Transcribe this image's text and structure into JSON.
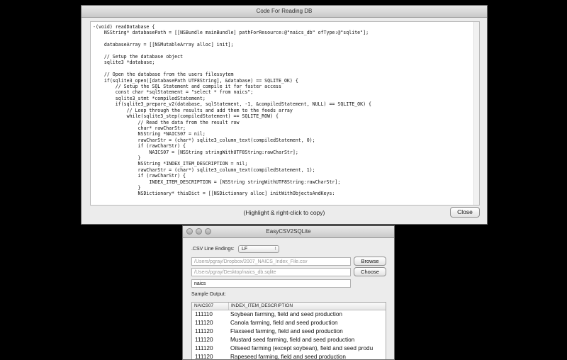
{
  "code_window": {
    "title": "Code For Reading DB",
    "code": "-(void) readDatabase {\n    NSString* databasePath = [[NSBundle mainBundle] pathForResource:@\"naics_db\" ofType:@\"sqlite\"];\n\n    databaseArray = [[NSMutableArray alloc] init];\n\n    // Setup the database object\n    sqlite3 *database;\n\n    // Open the database from the users filessytem\n    if(sqlite3_open([databasePath UTF8String], &database) == SQLITE_OK) {\n        // Setup the SQL Statement and compile it for faster access\n        const char *sqlStatement = \"select * from naics\";\n        sqlite3_stmt *compiledStatement;\n        if(sqlite3_prepare_v2(database, sqlStatement, -1, &compiledStatement, NULL) == SQLITE_OK) {\n            // Loop through the results and add them to the feeds array\n            while(sqlite3_step(compiledStatement) == SQLITE_ROW) {\n                // Read the data from the result row\n                char* rawCharStr;\n                NSString *NAICS07 = nil;\n                rawCharStr = (char*) sqlite3_column_text(compiledStatement, 0);\n                if (rawCharStr) {\n                    NAICS07 = [NSString stringWithUTF8String:rawCharStr];\n                }\n                NSString *INDEX_ITEM_DESCRIPTION = nil;\n                rawCharStr = (char*) sqlite3_column_text(compiledStatement, 1);\n                if (rawCharStr) {\n                    INDEX_ITEM_DESCRIPTION = [NSString stringWithUTF8String:rawCharStr];\n                }\n                NSDictionary* thisDict = [[NSDictionary alloc] initWithObjectsAndKeys:",
    "hint": "(Highlight & right-click to copy)",
    "close_label": "Close"
  },
  "easy_window": {
    "title": "EasyCSV2SQLite",
    "line_endings_label": ".CSV Line Endings:",
    "line_endings_value": "LF",
    "csv_path": "/Users/pgray/Dropbox/2007_NAICS_Index_File.csv",
    "browse_label": "Browse",
    "db_path": "/Users/pgray/Desktop/naics_db.sqlite",
    "choose_label": "Choose",
    "table_name": "naics",
    "sample_output_label": "Sample Output:",
    "columns": [
      "NAICS07",
      "INDEX_ITEM_DESCRIPTION"
    ],
    "rows": [
      [
        "111110",
        "Soybean farming, field and seed production"
      ],
      [
        "111120",
        "Canola farming, field and seed production"
      ],
      [
        "111120",
        "Flaxseed farming, field and seed production"
      ],
      [
        "111120",
        "Mustard seed farming, field and seed production"
      ],
      [
        "111120",
        "Oilseed farming (except soybean), field and seed produ"
      ],
      [
        "111120",
        "Rapeseed farming, field and seed production"
      ]
    ]
  }
}
